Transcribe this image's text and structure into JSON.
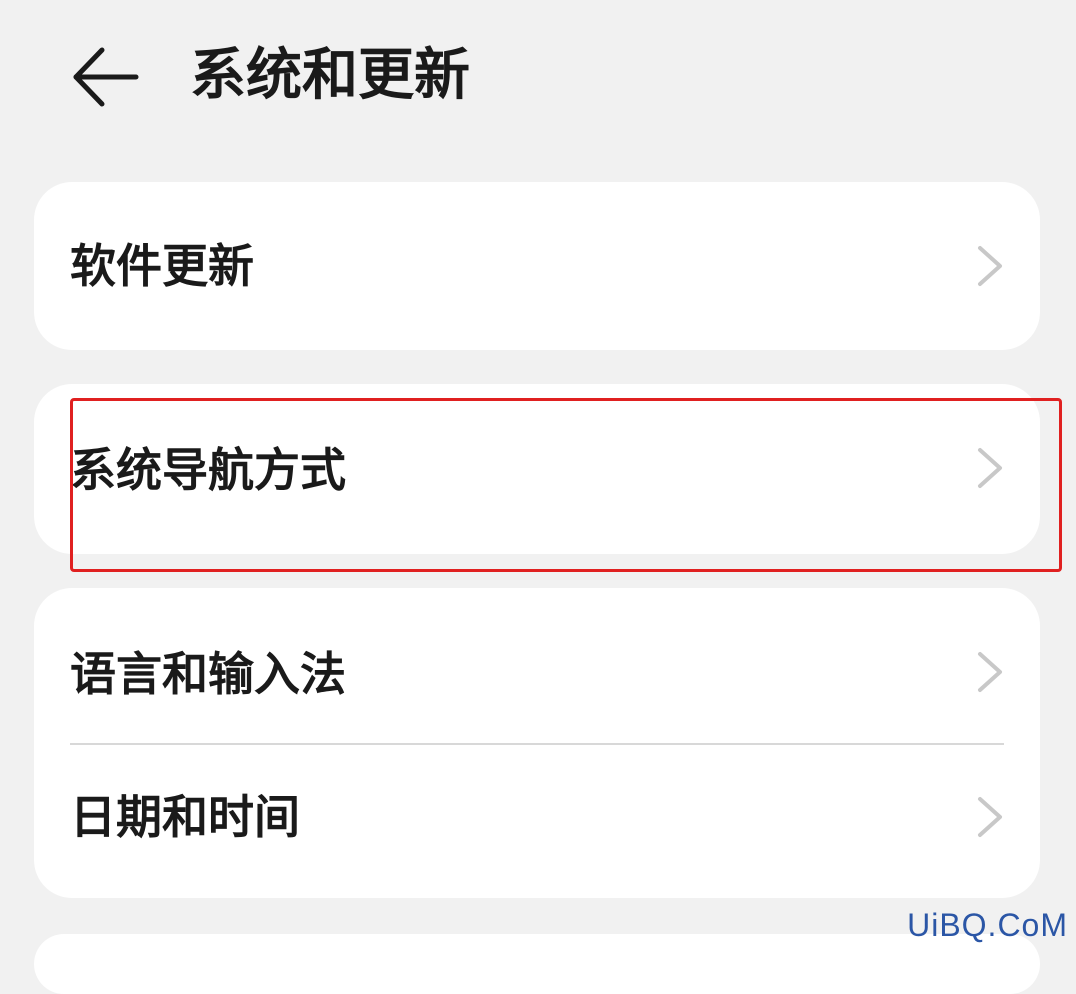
{
  "header": {
    "title": "系统和更新",
    "back_icon": "arrow-left-icon"
  },
  "cards": [
    {
      "items": [
        {
          "label": "软件更新",
          "icon": "chevron-right-icon"
        }
      ]
    },
    {
      "items": [
        {
          "label": "系统导航方式",
          "icon": "chevron-right-icon",
          "highlighted": true
        }
      ]
    },
    {
      "items": [
        {
          "label": "语言和输入法",
          "icon": "chevron-right-icon"
        },
        {
          "label": "日期和时间",
          "icon": "chevron-right-icon"
        }
      ]
    }
  ],
  "annotation": {
    "highlight_color": "#e02020"
  },
  "watermark": {
    "text": "UiBQ.CoM",
    "color": "#2b56a6"
  },
  "colors": {
    "background": "#f1f1f1",
    "card": "#ffffff",
    "text": "#1a1a1a",
    "chevron": "#c8c8c8",
    "divider": "#d8d8d8"
  }
}
